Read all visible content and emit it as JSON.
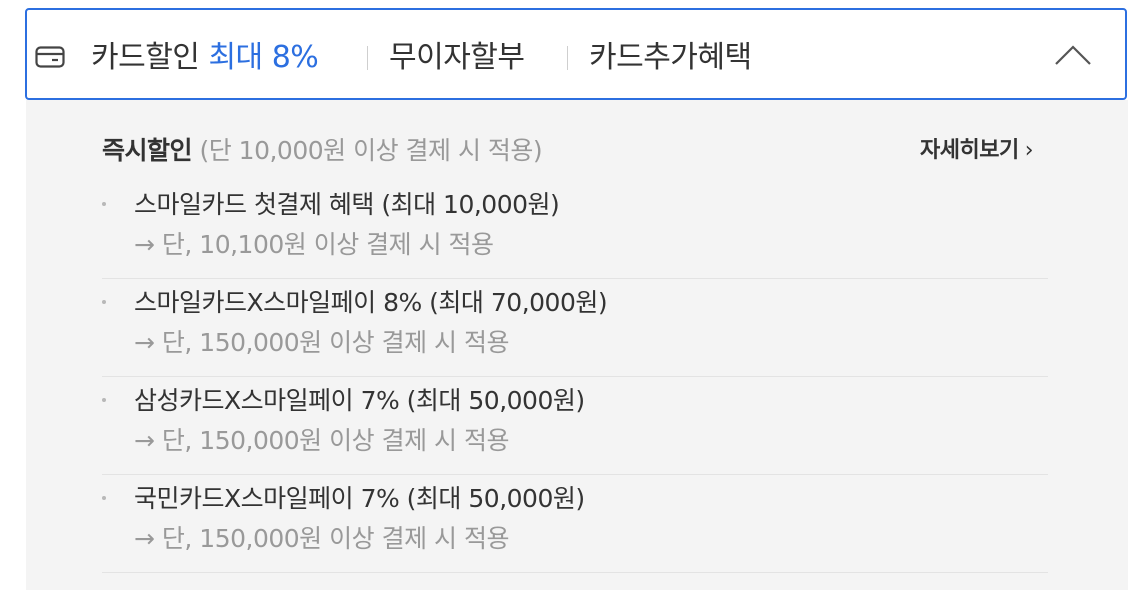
{
  "header": {
    "tab_card_label": "카드할인",
    "tab_card_highlight": "최대 8%",
    "tab_noint_label": "무이자할부",
    "tab_extra_label": "카드추가혜택",
    "icons": {
      "card": "card-icon",
      "collapse": "chevron-up-icon"
    },
    "accent_color": "#2c6fe0"
  },
  "panel": {
    "title": "즉시할인",
    "title_note": "(단 10,000원 이상 결제 시 적용)",
    "detail_link": "자세히보기",
    "detail_arrow": "›",
    "items": [
      {
        "title": "스마일카드 첫결제 혜택 (최대 10,000원)",
        "condition": "→ 단, 10,100원 이상 결제 시 적용"
      },
      {
        "title": "스마일카드X스마일페이 8% (최대 70,000원)",
        "condition": "→ 단, 150,000원 이상 결제 시 적용"
      },
      {
        "title": "삼성카드X스마일페이 7% (최대 50,000원)",
        "condition": "→ 단, 150,000원 이상 결제 시 적용"
      },
      {
        "title": "국민카드X스마일페이 7% (최대 50,000원)",
        "condition": "→ 단, 150,000원 이상 결제 시 적용"
      }
    ]
  }
}
